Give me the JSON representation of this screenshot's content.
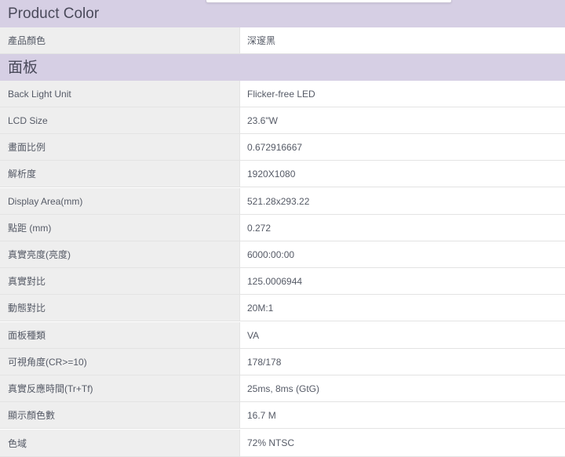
{
  "sections": {
    "product_color_title": "Product Color",
    "panel_title": "面板"
  },
  "product_color_rows": [
    {
      "label": "產品顏色",
      "value": "深邃黑"
    }
  ],
  "panel_rows": [
    {
      "label": "Back Light Unit",
      "value": "Flicker-free LED"
    },
    {
      "label": "LCD Size",
      "value": "23.6\"W"
    },
    {
      "label": "畫面比例",
      "value": "0.672916667"
    },
    {
      "label": "解析度",
      "value": "1920X1080"
    },
    {
      "label": "Display Area(mm)",
      "value": "521.28x293.22"
    },
    {
      "label": "點距 (mm)",
      "value": "0.272"
    },
    {
      "label": "真實亮度(亮度)",
      "value": "6000:00:00"
    },
    {
      "label": "真實對比",
      "value": "125.0006944"
    },
    {
      "label": "動態對比",
      "value": "20M:1"
    },
    {
      "label": "面板種類",
      "value": "VA"
    },
    {
      "label": "可視角度(CR>=10)",
      "value": "178/178"
    },
    {
      "label": "真實反應時間(Tr+Tf)",
      "value": "25ms, 8ms (GtG)"
    },
    {
      "label": "顯示顏色數",
      "value": "16.7 M"
    },
    {
      "label": "色域",
      "value": "72% NTSC"
    }
  ],
  "colors": {
    "header_bg": "#d6cfe4",
    "label_bg": "#eeeeee",
    "value_bg": "#ffffff",
    "text": "#555a66"
  }
}
